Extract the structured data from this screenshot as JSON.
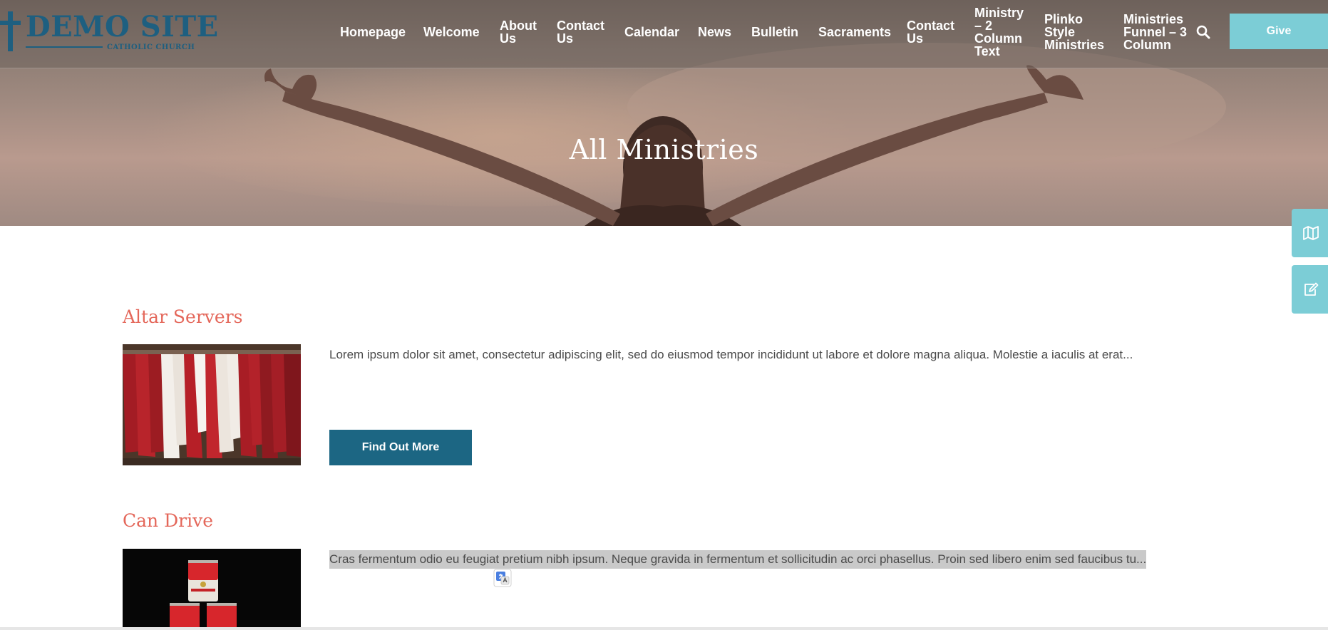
{
  "site": {
    "name": "DEMO SITE",
    "subtitle": "CATHOLIC CHURCH"
  },
  "nav": {
    "items": [
      {
        "id": "homepage",
        "label": "Homepage"
      },
      {
        "id": "welcome",
        "label": "Welcome"
      },
      {
        "id": "about-us",
        "label": "About Us"
      },
      {
        "id": "contact-us",
        "label": "Contact Us"
      },
      {
        "id": "calendar",
        "label": "Calendar"
      },
      {
        "id": "news",
        "label": "News"
      },
      {
        "id": "bulletin",
        "label": "Bulletin"
      },
      {
        "id": "sacraments",
        "label": "Sacraments"
      },
      {
        "id": "contact-us-2",
        "label": "Contact Us"
      },
      {
        "id": "ministry-2-column-text",
        "label": "Ministry – 2 Column Text"
      },
      {
        "id": "plinko-style-ministries",
        "label": "Plinko Style Ministries"
      },
      {
        "id": "ministries-funnel-3-column",
        "label": "Ministries Funnel – 3 Column"
      }
    ],
    "search_icon": "search-icon",
    "give_label": "Give"
  },
  "hero": {
    "title": "All Ministries"
  },
  "side_tabs": {
    "map_icon": "map-icon",
    "edit_icon": "edit-icon"
  },
  "ministries": [
    {
      "title": "Altar Servers",
      "description": "Lorem ipsum dolor sit amet, consectetur adipiscing elit, sed do eiusmod tempor incididunt ut labore et dolore magna aliqua. Molestie a iaculis at erat...",
      "button_label": "Find Out More"
    },
    {
      "title": "Can Drive",
      "description": "Cras fermentum odio eu feugiat pretium nibh ipsum. Neque gravida in fermentum et sollicitudin ac orci phasellus. Proin sed libero enim sed faucibus tu..."
    }
  ],
  "colors": {
    "brand_blue": "#1e5f80",
    "accent_teal": "#7ccdd6",
    "button_blue": "#1c6683",
    "title_coral": "#e4675a"
  }
}
